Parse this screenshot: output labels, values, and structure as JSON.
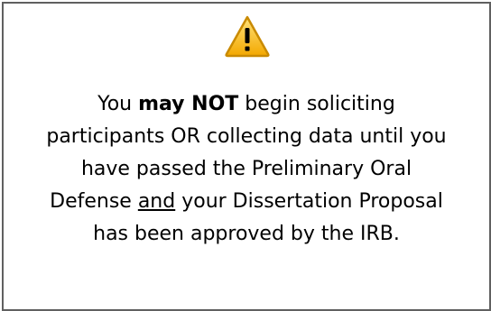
{
  "icon": {
    "name": "warning-icon",
    "fill": "#f5b400",
    "stroke": "#c98a00",
    "mark": "#000000"
  },
  "notice": {
    "line1_prefix": "You ",
    "line1_emphasis": "may NOT",
    "line1_suffix": " begin soliciting",
    "line2": "participants OR collecting data until you",
    "line3": "have passed the Preliminary Oral",
    "line4_prefix": "Defense ",
    "line4_underlined": "and",
    "line4_suffix": " your Dissertation Proposal",
    "line5": "has been approved by the IRB."
  }
}
